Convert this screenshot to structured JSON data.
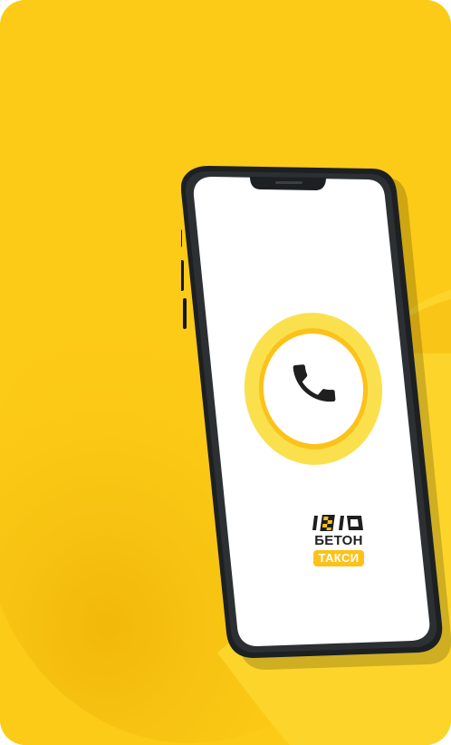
{
  "brand": {
    "name_top": "БЕТОН",
    "name_bottom": "ТАКСИ"
  },
  "icons": {
    "call": "phone-handset-icon",
    "logo": "taxi-checker-logo-icon"
  },
  "colors": {
    "background": "#fccb17",
    "accent_yellow": "#fcc21a",
    "ring_yellow": "#fbe04e",
    "phone_frame": "#1d2022",
    "screen": "#ffffff",
    "text_dark": "#1f1f1f"
  }
}
